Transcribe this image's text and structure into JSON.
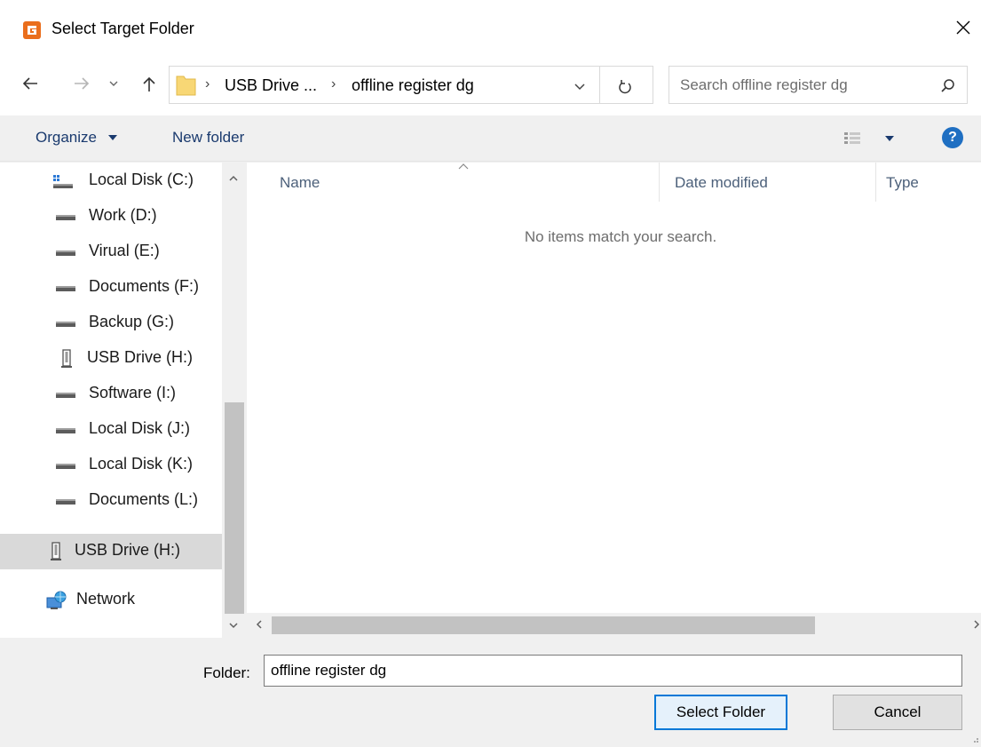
{
  "window": {
    "title": "Select Target Folder",
    "accent_color": "#ea6e1c"
  },
  "address": {
    "crumbs": [
      "USB Drive ...",
      "offline register dg"
    ],
    "search_placeholder": "Search offline register dg"
  },
  "toolbar": {
    "organize_label": "Organize",
    "newfolder_label": "New folder",
    "help_label": "?"
  },
  "nav": {
    "items": [
      {
        "label": "Local Disk (C:)",
        "icon": "system-drive-icon"
      },
      {
        "label": "Work (D:)",
        "icon": "drive-icon"
      },
      {
        "label": "Virual (E:)",
        "icon": "drive-icon"
      },
      {
        "label": "Documents (F:)",
        "icon": "drive-icon"
      },
      {
        "label": "Backup (G:)",
        "icon": "drive-icon"
      },
      {
        "label": "USB Drive (H:)",
        "icon": "usb-drive-icon"
      },
      {
        "label": "Software (I:)",
        "icon": "drive-icon"
      },
      {
        "label": "Local Disk (J:)",
        "icon": "drive-icon"
      },
      {
        "label": "Local Disk (K:)",
        "icon": "drive-icon"
      },
      {
        "label": "Documents (L:)",
        "icon": "drive-icon"
      },
      {
        "label": "USB Drive (H:)",
        "icon": "usb-drive-icon",
        "selected": true
      },
      {
        "label": "Network",
        "icon": "network-icon"
      }
    ]
  },
  "files": {
    "columns": [
      "Name",
      "Date modified",
      "Type"
    ],
    "empty_message": "No items match your search."
  },
  "footer": {
    "folder_label": "Folder:",
    "folder_value": "offline register dg",
    "select_button": "Select Folder",
    "cancel_button": "Cancel"
  }
}
